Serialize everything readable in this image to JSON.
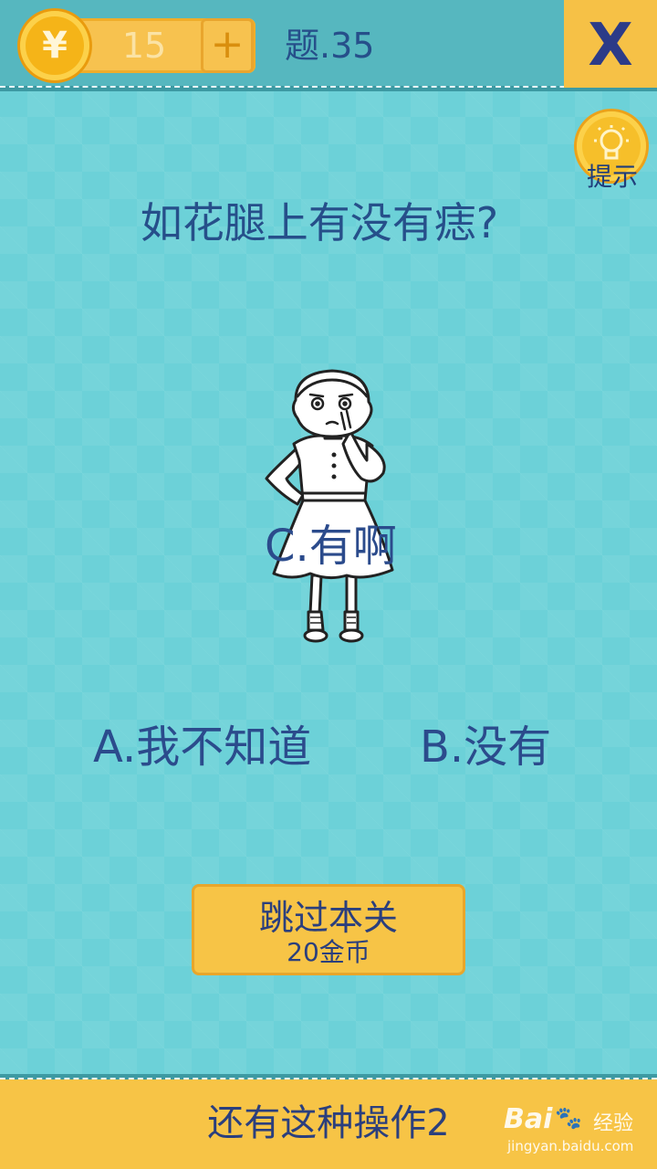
{
  "header": {
    "coin_symbol": "¥",
    "coin_count": "15",
    "plus_label": "+",
    "level_label": "题.35",
    "close_label": "X"
  },
  "hint": {
    "label": "提示",
    "icon": "lightbulb-icon"
  },
  "question": "如花腿上有没有痣?",
  "options": {
    "a": "A.我不知道",
    "b": "B.没有",
    "c": "C.有啊"
  },
  "skip": {
    "title": "跳过本关",
    "cost": "20金币"
  },
  "footer": {
    "title": "还有这种操作2"
  },
  "watermark": {
    "logo": "Bai",
    "paw": "🐾",
    "logo_suffix": "经验",
    "url": "jingyan.baidu.com"
  },
  "colors": {
    "background": "#6cd1d8",
    "topbar": "#56b7bf",
    "accent_yellow": "#f7c446",
    "text_blue": "#264f8a"
  }
}
